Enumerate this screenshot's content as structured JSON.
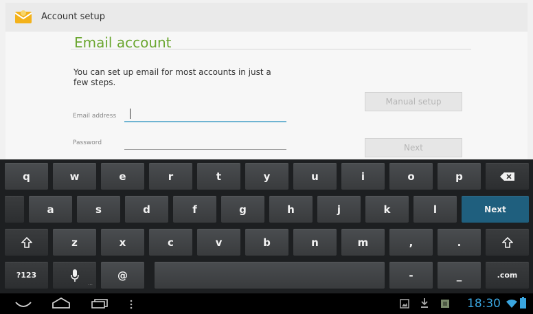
{
  "actionbar": {
    "title": "Account setup",
    "icon": "email-app-icon"
  },
  "form": {
    "heading": "Email account",
    "intro": "You can set up email for most accounts in just a few steps.",
    "email_label": "Email address",
    "email_value": "",
    "password_label": "Password",
    "password_value": "",
    "manual_setup_label": "Manual setup",
    "next_label": "Next"
  },
  "keyboard": {
    "row1": [
      "q",
      "w",
      "e",
      "r",
      "t",
      "y",
      "u",
      "i",
      "o",
      "p"
    ],
    "backspace_icon": "backspace-icon",
    "row2": [
      "a",
      "s",
      "d",
      "f",
      "g",
      "h",
      "j",
      "k",
      "l"
    ],
    "action_label": "Next",
    "shift_icon": "shift-icon",
    "row3": [
      "z",
      "x",
      "c",
      "v",
      "b",
      "n",
      "m",
      ",",
      "."
    ],
    "symbols_label": "?123",
    "mic_icon": "microphone-icon",
    "at_label": "@",
    "dash_label": "-",
    "underscore_label": "_",
    "dotcom_label": ".com"
  },
  "navbar": {
    "icons": [
      "back-icon",
      "home-icon",
      "recent-apps-icon",
      "menu-icon",
      "screenshot-icon",
      "download-icon",
      "notification-icon",
      "wifi-icon",
      "battery-icon"
    ],
    "time": "18:30"
  },
  "colors": {
    "accent_green": "#6aa62f",
    "accent_blue": "#3aa6e0",
    "next_key": "#1f5f7e"
  }
}
